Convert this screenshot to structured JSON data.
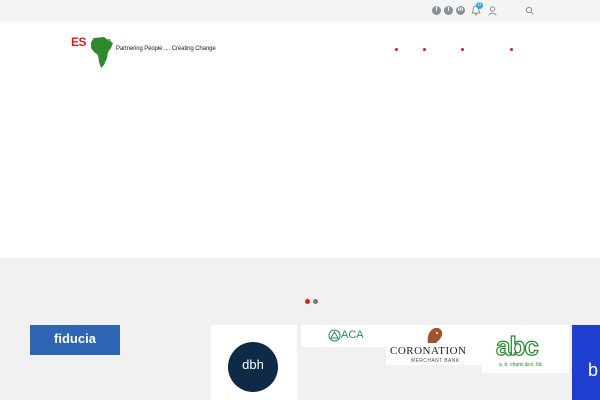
{
  "topbar": {
    "social": [
      {
        "icon": "facebook-icon",
        "glyph": "f"
      },
      {
        "icon": "twitter-icon",
        "glyph": "t"
      },
      {
        "icon": "linkedin-icon",
        "glyph": "in"
      }
    ],
    "notification_count": "0"
  },
  "header": {
    "logo_es": "ES",
    "logo_africa": "Africa",
    "tagline": "Partnering People .... Creating Change"
  },
  "partners": {
    "logos": [
      {
        "name": "fiducia",
        "text": "fiducia"
      },
      {
        "name": "dbh",
        "text": "dbh"
      },
      {
        "name": "aca",
        "text": "ACA"
      },
      {
        "name": "coronation",
        "text": "CORONATION",
        "sub": "MERCHANT BANK"
      },
      {
        "name": "abc",
        "text": "abc",
        "sub": "a. b. chami &co. ltd."
      },
      {
        "name": "partial",
        "text": "b"
      }
    ]
  },
  "colors": {
    "accent_red": "#d61f26",
    "africa_green": "#2d8a2d",
    "topbar_bg": "#f4f4f4",
    "partners_bg": "#f1f1f1",
    "badge_blue": "#2fa7d8"
  }
}
